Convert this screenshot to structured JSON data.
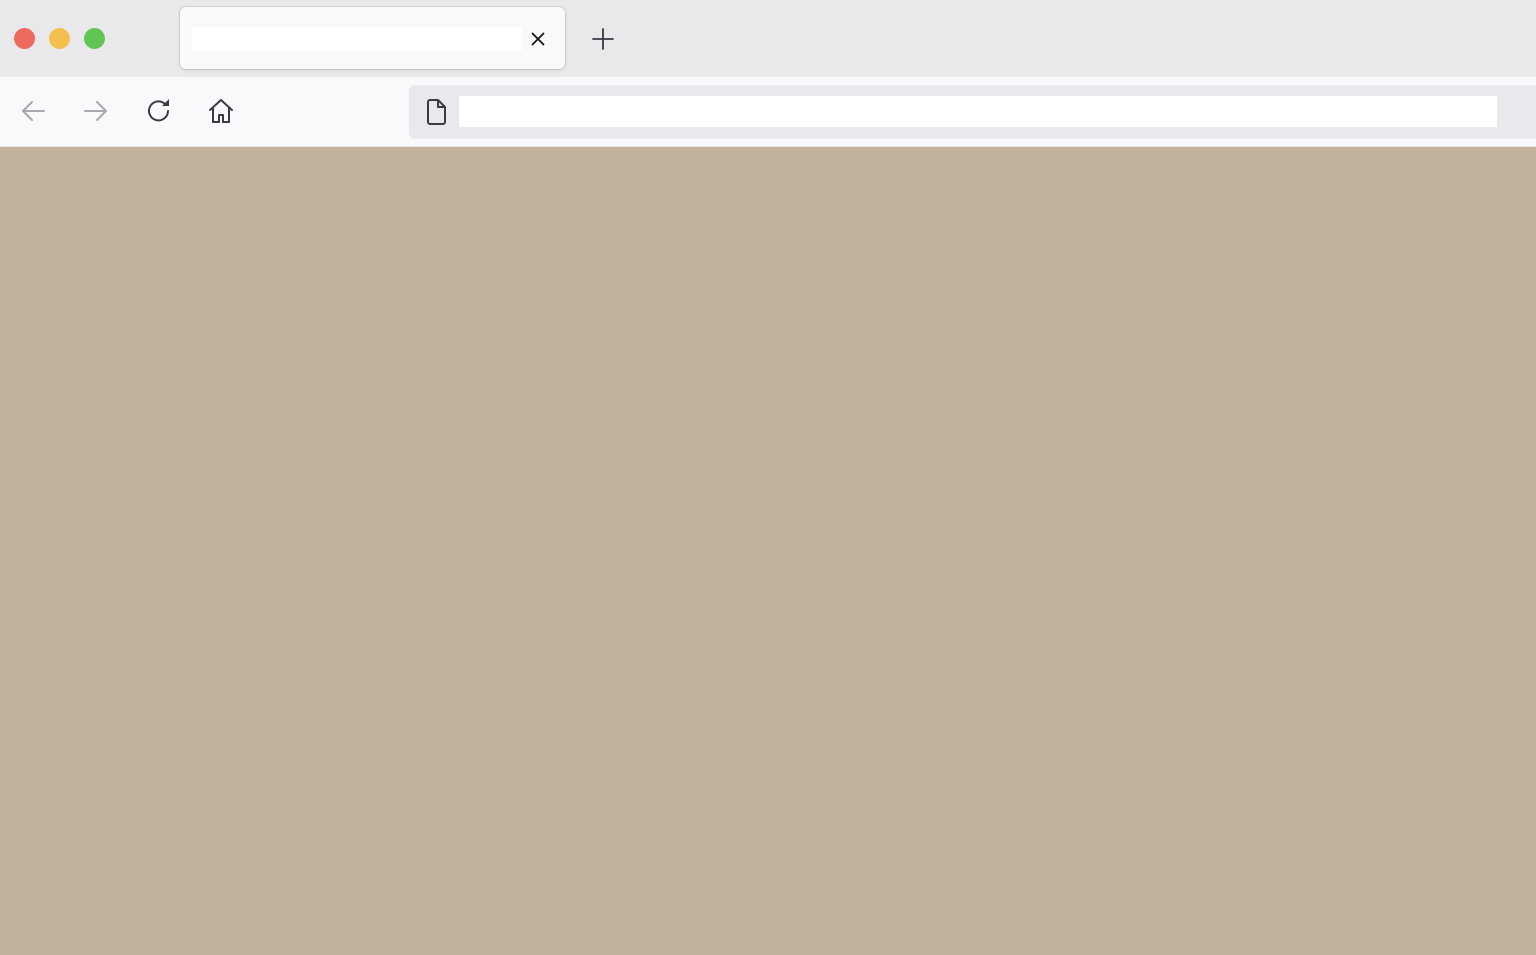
{
  "window": {
    "controls": {
      "close_color": "#ec6a5e",
      "minimize_color": "#f4bf4f",
      "maximize_color": "#61c554"
    }
  },
  "tabs": [
    {
      "title": "",
      "active": true,
      "close_icon": "close-icon"
    }
  ],
  "tabstrip": {
    "new_tab_icon": "plus-icon"
  },
  "navigation": {
    "back_icon": "arrow-left-icon",
    "back_enabled": false,
    "forward_icon": "arrow-right-icon",
    "forward_enabled": false,
    "reload_icon": "reload-icon",
    "home_icon": "home-icon"
  },
  "urlbar": {
    "page_icon": "document-icon",
    "value": "",
    "placeholder": ""
  },
  "content": {
    "background_color": "#c1b29d"
  }
}
